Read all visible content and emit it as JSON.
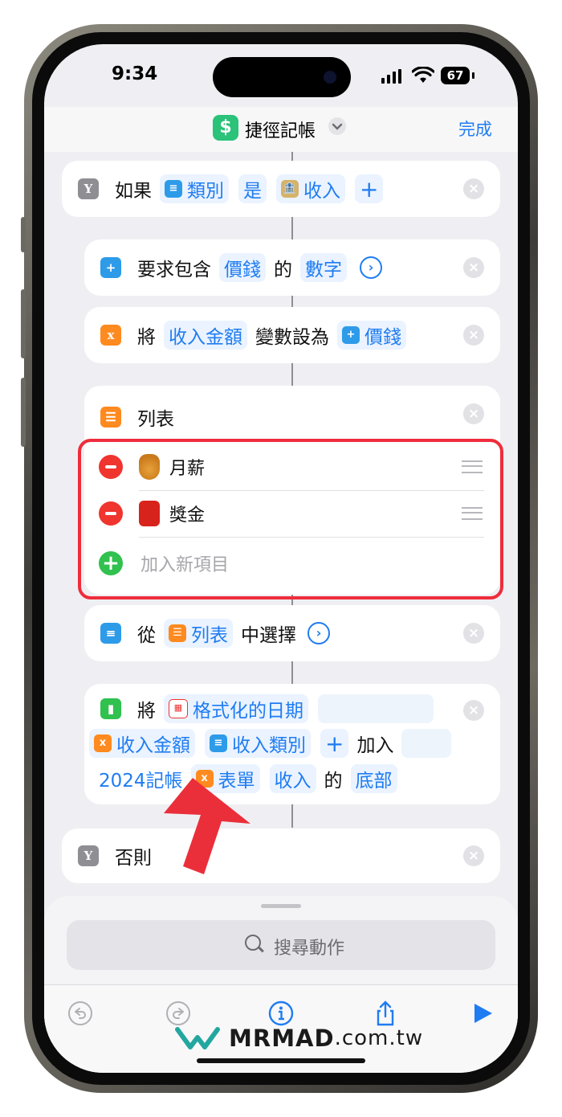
{
  "status_bar": {
    "time": "9:34",
    "battery": "67"
  },
  "header": {
    "app_icon": "$",
    "title": "捷徑記帳",
    "done_label": "完成"
  },
  "if_block": {
    "label": "如果",
    "var_label": "類別",
    "operator": "是",
    "value_label": "收入",
    "add_symbol": "+"
  },
  "ask_block": {
    "label": "要求包含",
    "token1": "價錢",
    "of": "的",
    "token2": "數字"
  },
  "set_var_block": {
    "label": "將",
    "var_name": "收入金額",
    "middle": "變數設為",
    "value": "價錢"
  },
  "list_block": {
    "title": "列表",
    "items": [
      {
        "emoji": "money-bag",
        "label": "月薪"
      },
      {
        "emoji": "red-envelope",
        "label": "獎金"
      }
    ],
    "add_placeholder": "加入新項目"
  },
  "choose_block": {
    "label": "從",
    "token": "列表",
    "suffix": "中選擇"
  },
  "numbers_block": {
    "label": "將",
    "token_date": "格式化的日期",
    "token_amount": "收入金額",
    "token_category": "收入類別",
    "plus": "+",
    "add_label": "加入",
    "file_label": "2024記帳",
    "token_sheet": "表單",
    "token_income": "收入",
    "of": "的",
    "token_bottom": "底部"
  },
  "otherwise_block": {
    "label": "否則"
  },
  "sheet": {
    "search_placeholder": "搜尋動作"
  },
  "watermark": {
    "brand": "MRMAD",
    "domain": ".com.tw"
  },
  "colors": {
    "accent": "#1f7cf2",
    "highlight_border": "#ef2d3c",
    "screen_bg": "#efeff3"
  }
}
